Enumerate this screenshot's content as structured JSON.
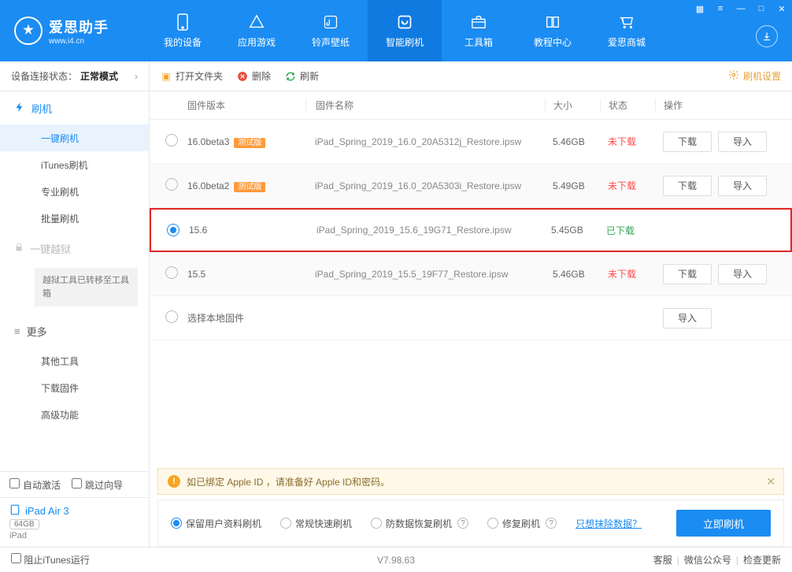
{
  "app": {
    "title": "爱思助手",
    "subtitle": "www.i4.cn"
  },
  "nav": {
    "items": [
      {
        "label": "我的设备"
      },
      {
        "label": "应用游戏"
      },
      {
        "label": "铃声壁纸"
      },
      {
        "label": "智能刷机"
      },
      {
        "label": "工具箱"
      },
      {
        "label": "教程中心"
      },
      {
        "label": "爱思商城"
      }
    ]
  },
  "sidebar": {
    "status_label": "设备连接状态：",
    "status_mode": "正常模式",
    "flash_title": "刷机",
    "subs": [
      "一键刷机",
      "iTunes刷机",
      "专业刷机",
      "批量刷机"
    ],
    "jailbreak_title": "一键越狱",
    "jailbreak_note": "越狱工具已转移至工具箱",
    "more_title": "更多",
    "more_subs": [
      "其他工具",
      "下载固件",
      "高级功能"
    ],
    "auto_activate": "自动激活",
    "skip_guide": "跳过向导",
    "device_name": "iPad Air 3",
    "device_cap": "64GB",
    "device_type": "iPad"
  },
  "toolbar": {
    "open": "打开文件夹",
    "delete": "删除",
    "refresh": "刷新",
    "settings": "刷机设置"
  },
  "headers": {
    "ver": "固件版本",
    "name": "固件名称",
    "size": "大小",
    "status": "状态",
    "ops": "操作"
  },
  "rows": [
    {
      "ver": "16.0beta3",
      "beta": "测试版",
      "name": "iPad_Spring_2019_16.0_20A5312j_Restore.ipsw",
      "size": "5.46GB",
      "status": "未下载",
      "status_type": "not",
      "selected": false,
      "download": true,
      "import": true
    },
    {
      "ver": "16.0beta2",
      "beta": "测试版",
      "name": "iPad_Spring_2019_16.0_20A5303i_Restore.ipsw",
      "size": "5.49GB",
      "status": "未下载",
      "status_type": "not",
      "selected": false,
      "download": true,
      "import": true
    },
    {
      "ver": "15.6",
      "beta": "",
      "name": "iPad_Spring_2019_15.6_19G71_Restore.ipsw",
      "size": "5.45GB",
      "status": "已下载",
      "status_type": "done",
      "selected": true,
      "download": false,
      "import": false
    },
    {
      "ver": "15.5",
      "beta": "",
      "name": "iPad_Spring_2019_15.5_19F77_Restore.ipsw",
      "size": "5.46GB",
      "status": "未下载",
      "status_type": "not",
      "selected": false,
      "download": true,
      "import": true
    },
    {
      "ver": "选择本地固件",
      "beta": "",
      "name": "",
      "size": "",
      "status": "",
      "status_type": "",
      "selected": false,
      "download": false,
      "import": true
    }
  ],
  "buttons": {
    "download": "下载",
    "import": "导入"
  },
  "warn": "如已绑定 Apple ID ，请准备好 Apple ID和密码。",
  "flash_opts": {
    "o1": "保留用户资料刷机",
    "o2": "常规快速刷机",
    "o3": "防数据恢复刷机",
    "o4": "修复刷机",
    "link": "只想抹除数据？",
    "go": "立即刷机"
  },
  "footer": {
    "block": "阻止iTunes运行",
    "version": "V7.98.63",
    "links": [
      "客服",
      "微信公众号",
      "检查更新"
    ]
  }
}
